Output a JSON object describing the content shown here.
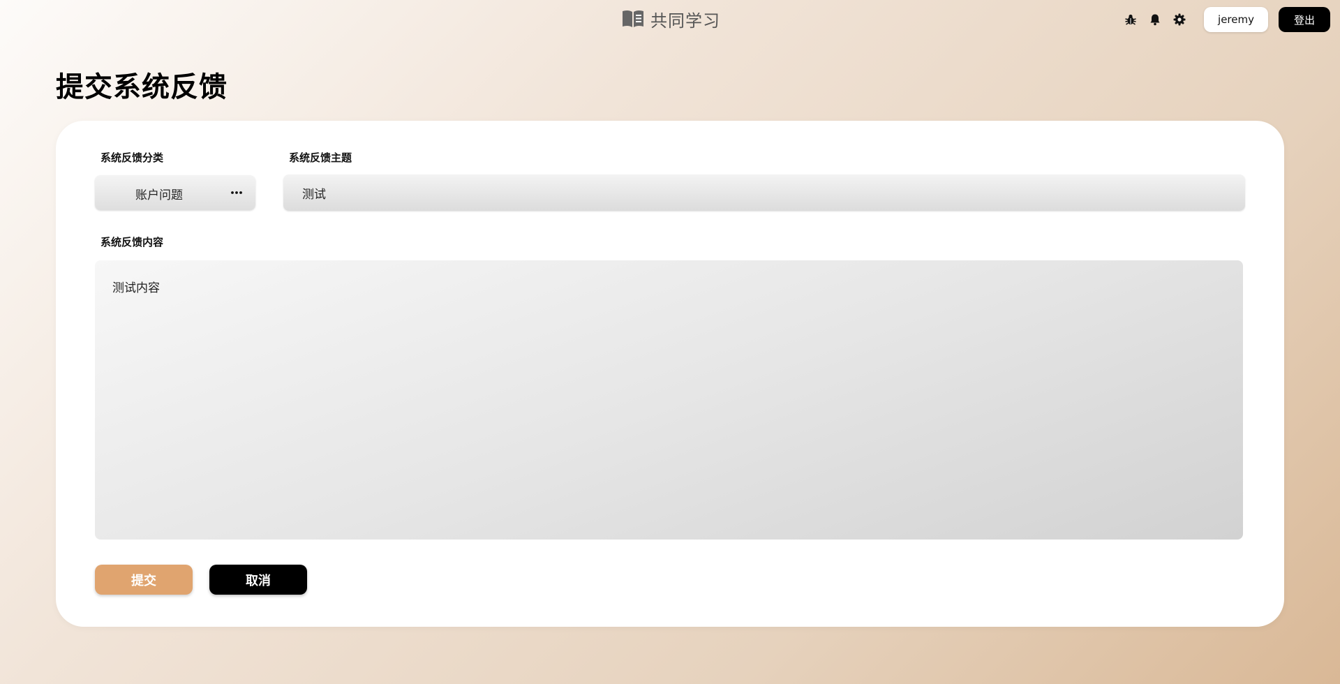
{
  "header": {
    "brand_icon": "book-icon",
    "brand_title": "共同学习",
    "actions": {
      "bug_icon": "bug-icon",
      "bell_icon": "bell-icon",
      "gear_icon": "gear-icon",
      "username": "jeremy",
      "logout_label": "登出"
    }
  },
  "page": {
    "title": "提交系统反馈"
  },
  "form": {
    "category": {
      "label": "系统反馈分类",
      "value": "账户问题",
      "more_icon": "ellipsis-icon"
    },
    "subject": {
      "label": "系统反馈主题",
      "value": "测试"
    },
    "content": {
      "label": "系统反馈内容",
      "value": "测试内容"
    },
    "submit_label": "提交",
    "cancel_label": "取消"
  },
  "colors": {
    "accent": "#e0a46f",
    "primary_dark": "#000000",
    "card_background": "#ffffff"
  }
}
